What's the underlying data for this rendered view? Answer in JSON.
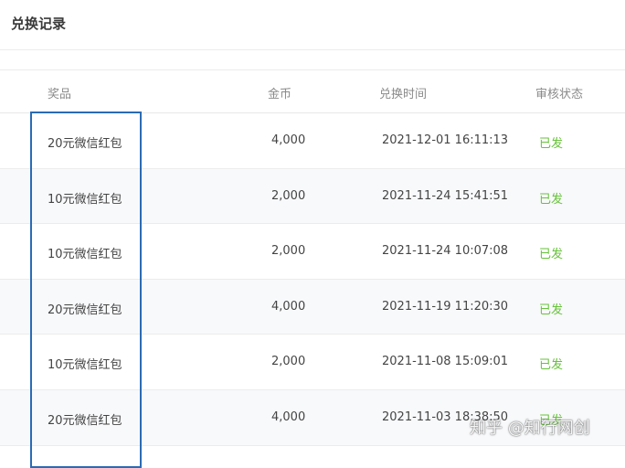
{
  "page": {
    "title": "兑换记录"
  },
  "table": {
    "headers": {
      "prize": "奖品",
      "coins": "金币",
      "time": "兑换时间",
      "status": "审核状态"
    },
    "rows": [
      {
        "prize": "20元微信红包",
        "coins": "4,000",
        "time": "2021-12-01  16:11:13",
        "status": "已发"
      },
      {
        "prize": "10元微信红包",
        "coins": "2,000",
        "time": "2021-11-24  15:41:51",
        "status": "已发"
      },
      {
        "prize": "10元微信红包",
        "coins": "2,000",
        "time": "2021-11-24  10:07:08",
        "status": "已发"
      },
      {
        "prize": "20元微信红包",
        "coins": "4,000",
        "time": "2021-11-19  11:20:30",
        "status": "已发"
      },
      {
        "prize": "10元微信红包",
        "coins": "2,000",
        "time": "2021-11-08  15:09:01",
        "status": "已发"
      },
      {
        "prize": "20元微信红包",
        "coins": "4,000",
        "time": "2021-11-03  18:38:50",
        "status": "已发"
      }
    ]
  },
  "colors": {
    "status_green": "#67c23a",
    "highlight_blue": "#2a6bb5"
  },
  "watermark": "知乎 @知行网创"
}
